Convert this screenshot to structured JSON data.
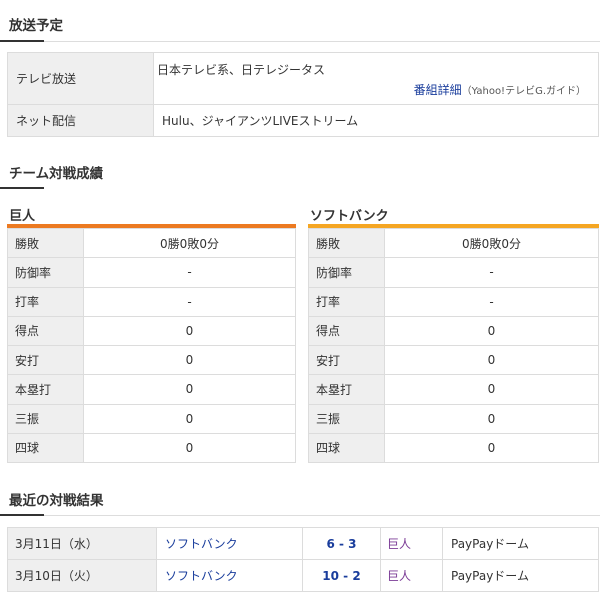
{
  "broadcast": {
    "title": "放送予定",
    "rows": [
      {
        "label": "テレビ放送",
        "value": "日本テレビ系、日テレジータス",
        "link": "番組詳細",
        "source": "（Yahoo!テレビG.ガイド）"
      },
      {
        "label": "ネット配信",
        "value": "Hulu、ジャイアンツLIVEストリーム"
      }
    ]
  },
  "team_stats": {
    "title": "チーム対戦成績",
    "labels": [
      "勝敗",
      "防御率",
      "打率",
      "得点",
      "安打",
      "本塁打",
      "三振",
      "四球"
    ],
    "teams": [
      {
        "name": "巨人",
        "color": "#ec7a21",
        "values": [
          "0勝0敗0分",
          "-",
          "-",
          "0",
          "0",
          "0",
          "0",
          "0"
        ]
      },
      {
        "name": "ソフトバンク",
        "color": "#f5a623",
        "values": [
          "0勝0敗0分",
          "-",
          "-",
          "0",
          "0",
          "0",
          "0",
          "0"
        ]
      }
    ]
  },
  "results": {
    "title": "最近の対戦結果",
    "rows": [
      {
        "date": "3月11日（水）",
        "home": "ソフトバンク",
        "score": "6 - 3",
        "away": "巨人",
        "venue": "PayPayドーム"
      },
      {
        "date": "3月10日（火）",
        "home": "ソフトバンク",
        "score": "10 - 2",
        "away": "巨人",
        "venue": "PayPayドーム"
      }
    ]
  }
}
